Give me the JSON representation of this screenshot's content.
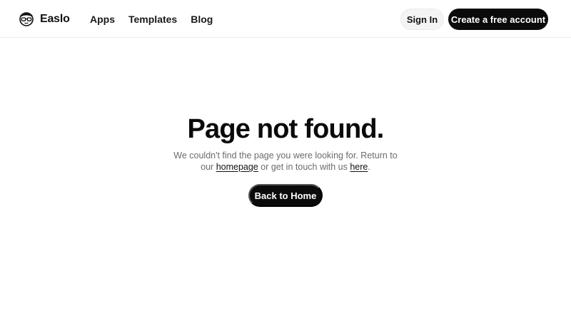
{
  "header": {
    "brand": {
      "name": "Easlo",
      "logo_icon": "glasses-face-logo"
    },
    "nav": [
      {
        "label": "Apps"
      },
      {
        "label": "Templates"
      },
      {
        "label": "Blog"
      }
    ],
    "sign_in_label": "Sign In",
    "cta_label": "Create a free account"
  },
  "main": {
    "title": "Page not found.",
    "message": {
      "line1": "We couldn't find the page you were looking for. Return to",
      "prefix": "our",
      "homepage_link": "homepage",
      "middle": "or get in touch with us",
      "here_link": "here",
      "suffix": "."
    },
    "back_button_label": "Back to Home"
  },
  "colors": {
    "primary": "#0b0b0b",
    "muted_text": "#6b6b6b",
    "secondary_button_bg": "#f4f4f4",
    "background": "#ffffff"
  }
}
